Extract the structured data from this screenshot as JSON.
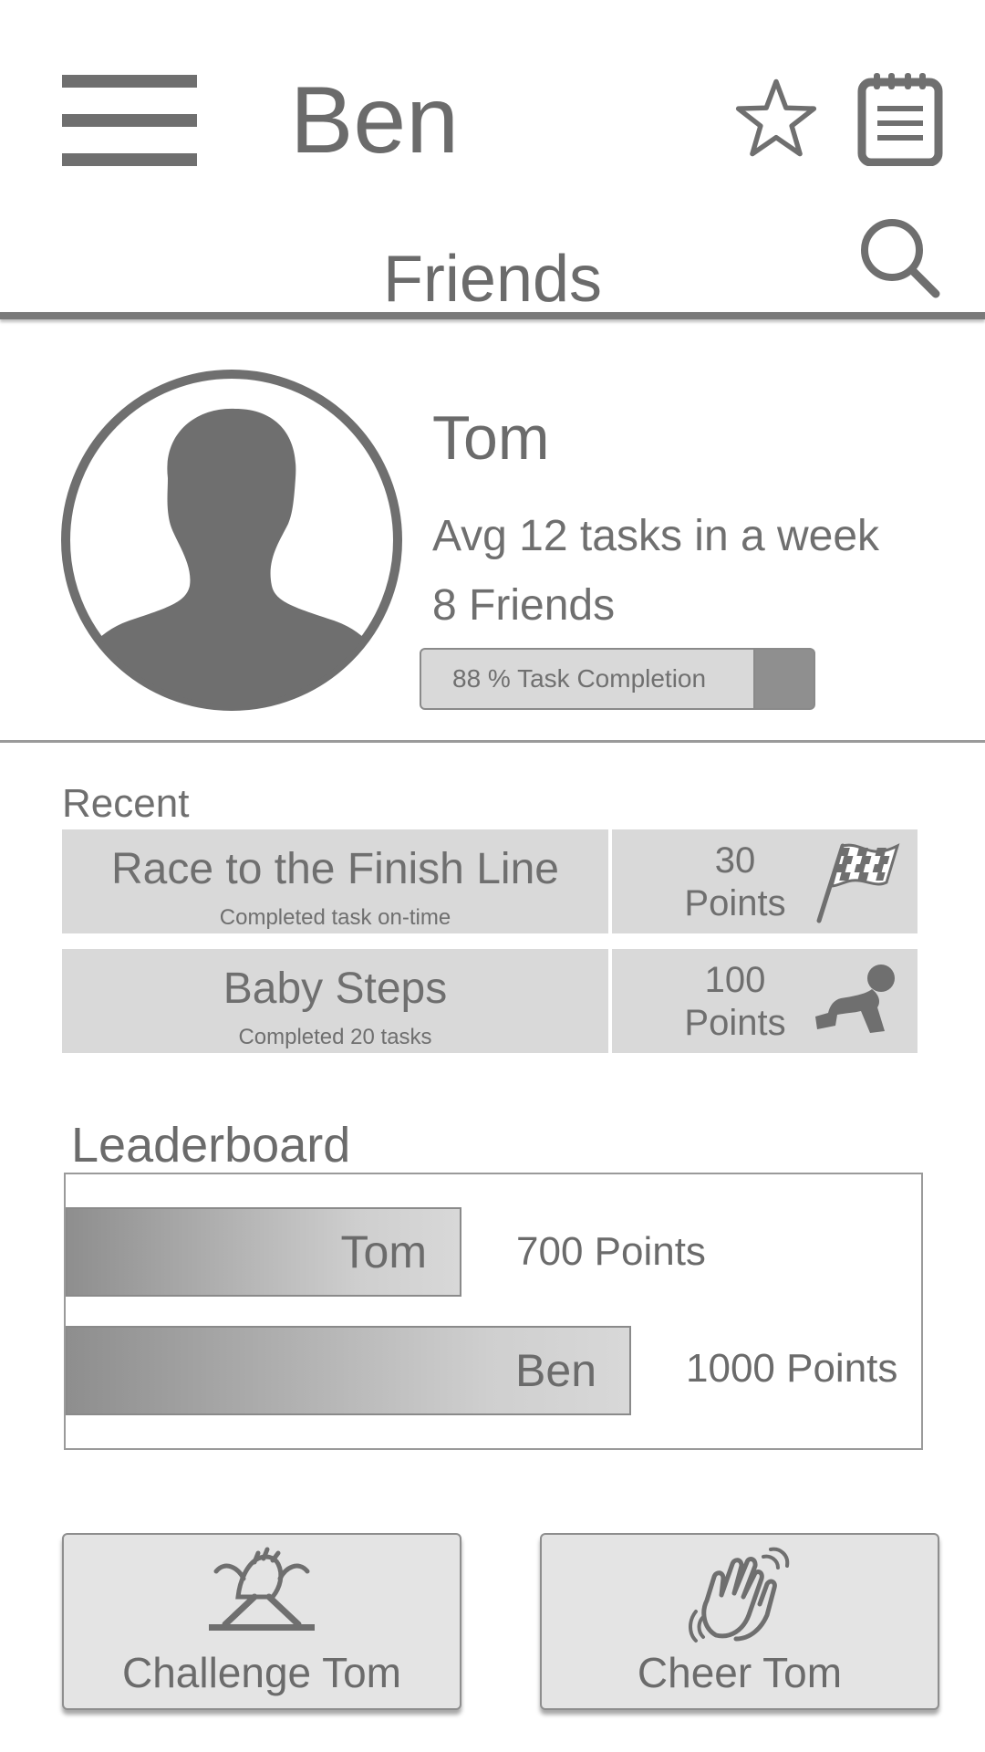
{
  "header": {
    "title": "Ben",
    "menu_icon": "hamburger-menu-icon",
    "favorite_icon": "star-icon",
    "calendar_icon": "calendar-notepad-icon",
    "search_icon": "search-icon"
  },
  "section": {
    "title": "Friends"
  },
  "profile": {
    "name": "Tom",
    "avg_tasks": "Avg 12 tasks in a week",
    "friends": "8 Friends",
    "completion_label": "88 % Task Completion",
    "completion_fraction": 0.85
  },
  "recent": {
    "label": "Recent",
    "items": [
      {
        "title": "Race to the Finish Line",
        "subtitle": "Completed task on-time",
        "points_value": "30",
        "points_unit": "Points",
        "icon": "checkered-flag-icon"
      },
      {
        "title": "Baby Steps",
        "subtitle": "Completed 20 tasks",
        "points_value": "100",
        "points_unit": "Points",
        "icon": "crawling-baby-icon"
      }
    ]
  },
  "leaderboard": {
    "label": "Leaderboard",
    "entries": [
      {
        "name": "Tom",
        "points_label": "700 Points",
        "points": 700
      },
      {
        "name": "Ben",
        "points_label": "1000 Points",
        "points": 1000
      }
    ]
  },
  "actions": {
    "challenge_label": "Challenge Tom",
    "challenge_icon": "arm-wrestling-icon",
    "cheer_label": "Cheer Tom",
    "cheer_icon": "clapping-hands-icon"
  },
  "colors": {
    "icon_gray": "#6f6f6f",
    "panel_gray": "#d9d9d9",
    "button_gray": "#e4e4e4"
  }
}
